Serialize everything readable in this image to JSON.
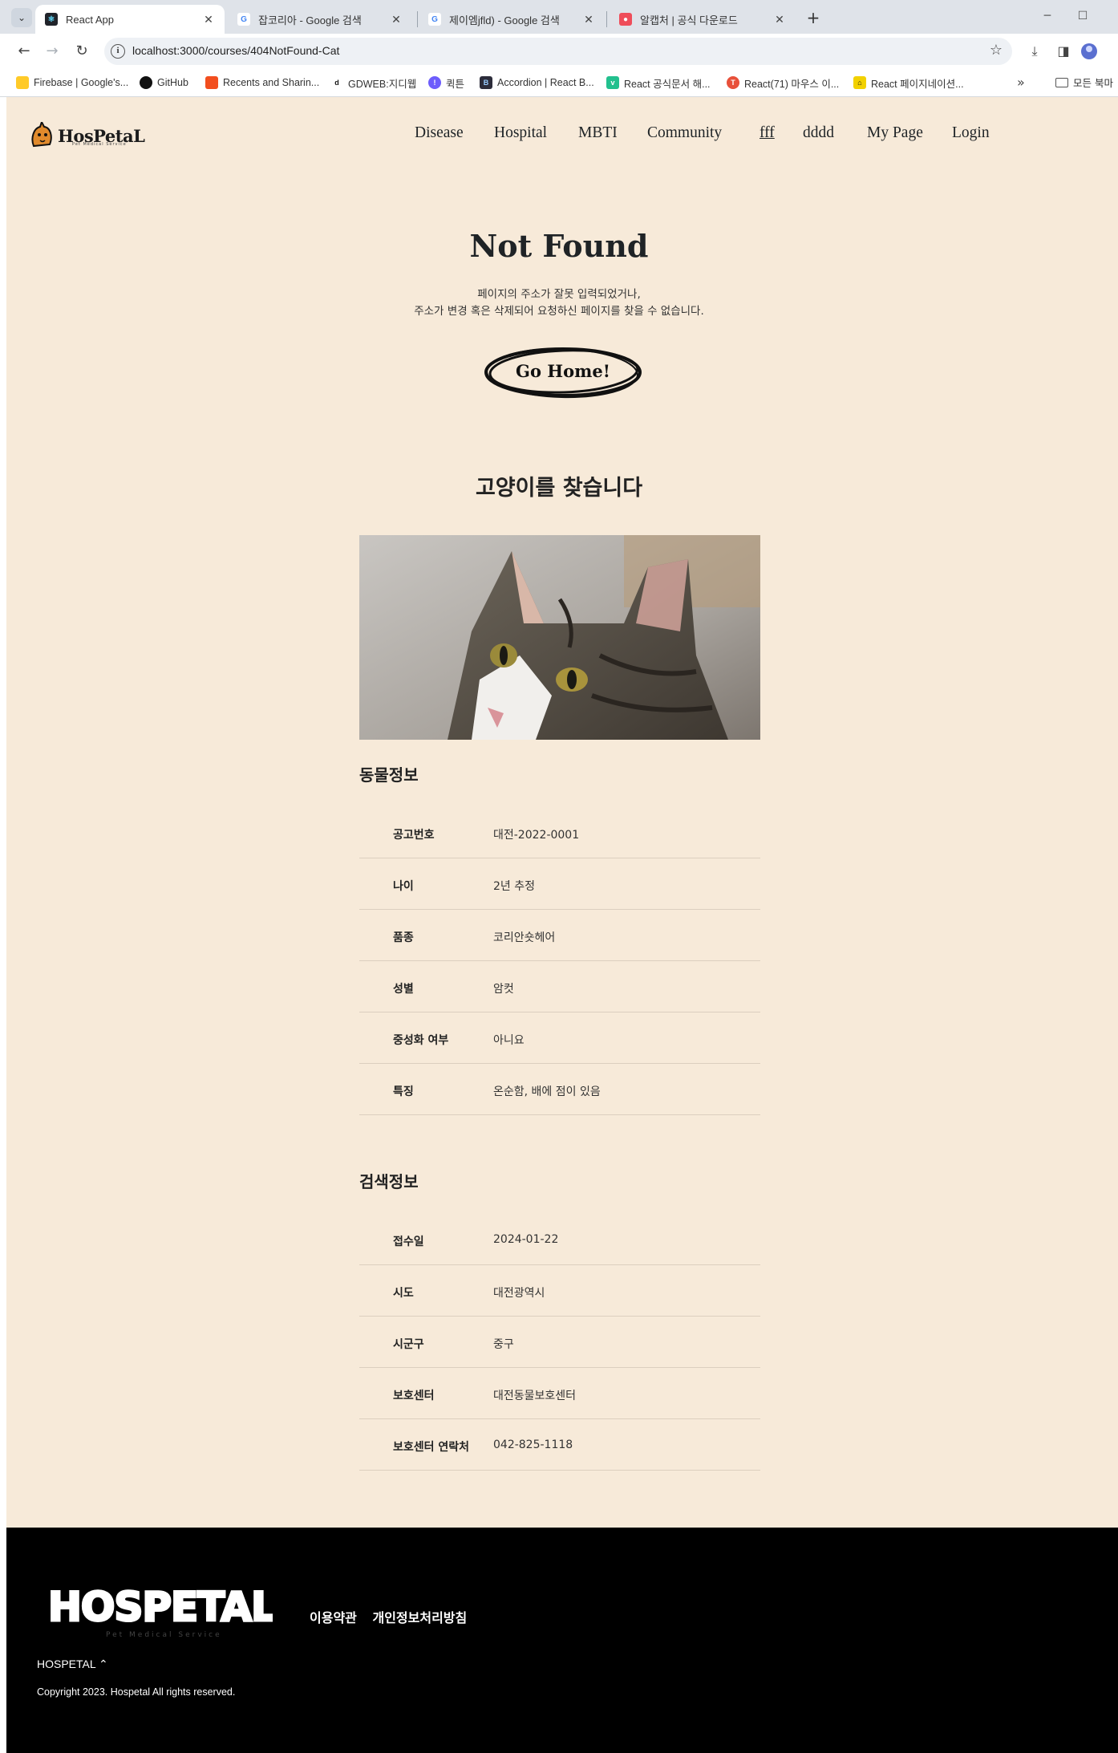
{
  "browser": {
    "tabs": [
      {
        "label": "React App",
        "active": true
      },
      {
        "label": "잡코리아 - Google 검색",
        "active": false
      },
      {
        "label": "제이엠jfld) - Google 검색",
        "active": false
      },
      {
        "label": "알캡처 | 공식 다운로드",
        "active": false
      }
    ],
    "url": "localhost:3000/courses/404NotFound-Cat",
    "bookmarks": [
      "Firebase | Google's...",
      "GitHub",
      "Recents and Sharin...",
      "GDWEB:지디웹",
      "퀵튼",
      "Accordion | React B...",
      "React 공식문서 해...",
      "React(71) 마우스 이...",
      "React 페이지네이션..."
    ],
    "bookmarks_folder": "모든 북마",
    "more_icon": "»"
  },
  "header": {
    "logo_text": "HosPetaL",
    "logo_sub": "Pet Medical Service",
    "nav": [
      "Disease",
      "Hospital",
      "MBTI",
      "Community",
      "fff",
      "dddd",
      "My Page",
      "Login"
    ]
  },
  "not_found": {
    "title": "Not Found",
    "line1": "페이지의 주소가 잘못 입력되었거나,",
    "line2": "주소가 변경 혹은 삭제되어 요청하신 페이지를 찾을 수 없습니다.",
    "button": "Go Home!"
  },
  "lost_cat": {
    "title": "고양이를 찾습니다",
    "animal_heading": "동물정보",
    "animal_info": [
      {
        "key": "공고번호",
        "value": "대전-2022-0001"
      },
      {
        "key": "나이",
        "value": "2년 추정"
      },
      {
        "key": "품종",
        "value": "코리안숏헤어"
      },
      {
        "key": "성별",
        "value": "암컷"
      },
      {
        "key": "중성화 여부",
        "value": "아니요"
      },
      {
        "key": "특징",
        "value": "온순함, 배에 점이 있음"
      }
    ],
    "search_heading": "검색정보",
    "search_info": [
      {
        "key": "접수일",
        "value": "2024-01-22"
      },
      {
        "key": "시도",
        "value": "대전광역시"
      },
      {
        "key": "시군구",
        "value": "중구"
      },
      {
        "key": "보호센터",
        "value": "대전동물보호센터"
      },
      {
        "key": "보호센터 연락처",
        "value": "042-825-1118"
      }
    ]
  },
  "footer": {
    "logo_text": "HOSPETAL",
    "logo_sub": "Pet Medical Service",
    "links": [
      "이용약관",
      "개인정보처리방침"
    ],
    "brand": "HOSPETAL ⌃",
    "copyright": "Copyright 2023. Hospetal All rights reserved."
  },
  "colors": {
    "page_bg": "#f7ead9",
    "footer_bg": "#000000",
    "text_dark": "#1f2326"
  }
}
